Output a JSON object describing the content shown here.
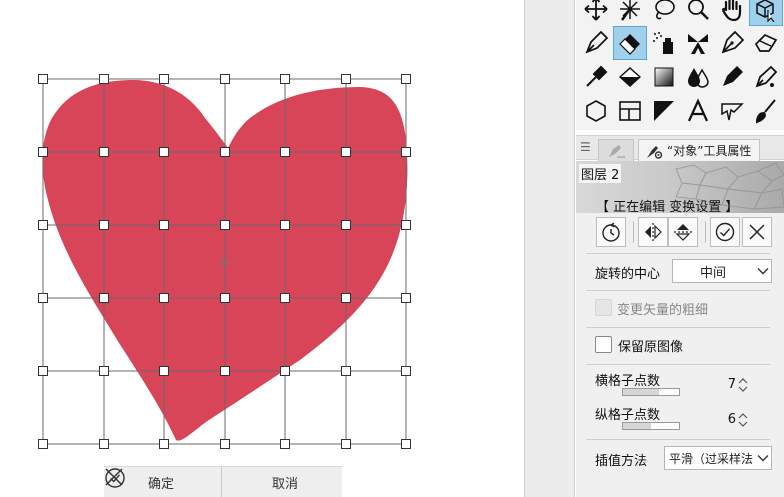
{
  "canvas": {
    "heart_color": "#d84458",
    "confirm_label": "确定",
    "cancel_label": "取消"
  },
  "tool_palette": {
    "rows": [
      [
        "move-icon",
        "sparkle-icon",
        "lasso-icon",
        "zoom-icon",
        "hand-icon",
        "object-select-icon"
      ],
      [
        "pen-nib-icon",
        "eraser-icon",
        "airbrush-icon",
        "ribbon-icon",
        "fountain-pen-icon",
        "soft-eraser-icon"
      ],
      [
        "eyedropper-icon",
        "fill-bucket-icon",
        "gradient-icon",
        "blend-drops-icon",
        "calligraphy-pen-icon",
        "pen-tool-icon"
      ],
      [
        "polygon-icon",
        "frame-layout-icon",
        "ruler-icon",
        "text-tool-icon",
        "speech-balloon-icon",
        "brush-icon"
      ]
    ],
    "active_tool": "eraser-icon",
    "accent": "#9fd0ec"
  },
  "tabs": {
    "active_label": "“对象”工具属性"
  },
  "panel": {
    "layer_name": "图层 2",
    "edit_title": "【 正在编辑 变换设置 】",
    "rotation_center_label": "旋转的中心",
    "rotation_center_value": "中间",
    "vector_width_label": "变更矢量的粗细",
    "keep_original_label": "保留原图像",
    "keep_original_checked": false,
    "h_grid_label": "横格子点数",
    "h_grid_value": "7",
    "v_grid_label": "纵格子点数",
    "v_grid_value": "6",
    "interp_label": "插值方法",
    "interp_value": "平滑（过采样法"
  }
}
